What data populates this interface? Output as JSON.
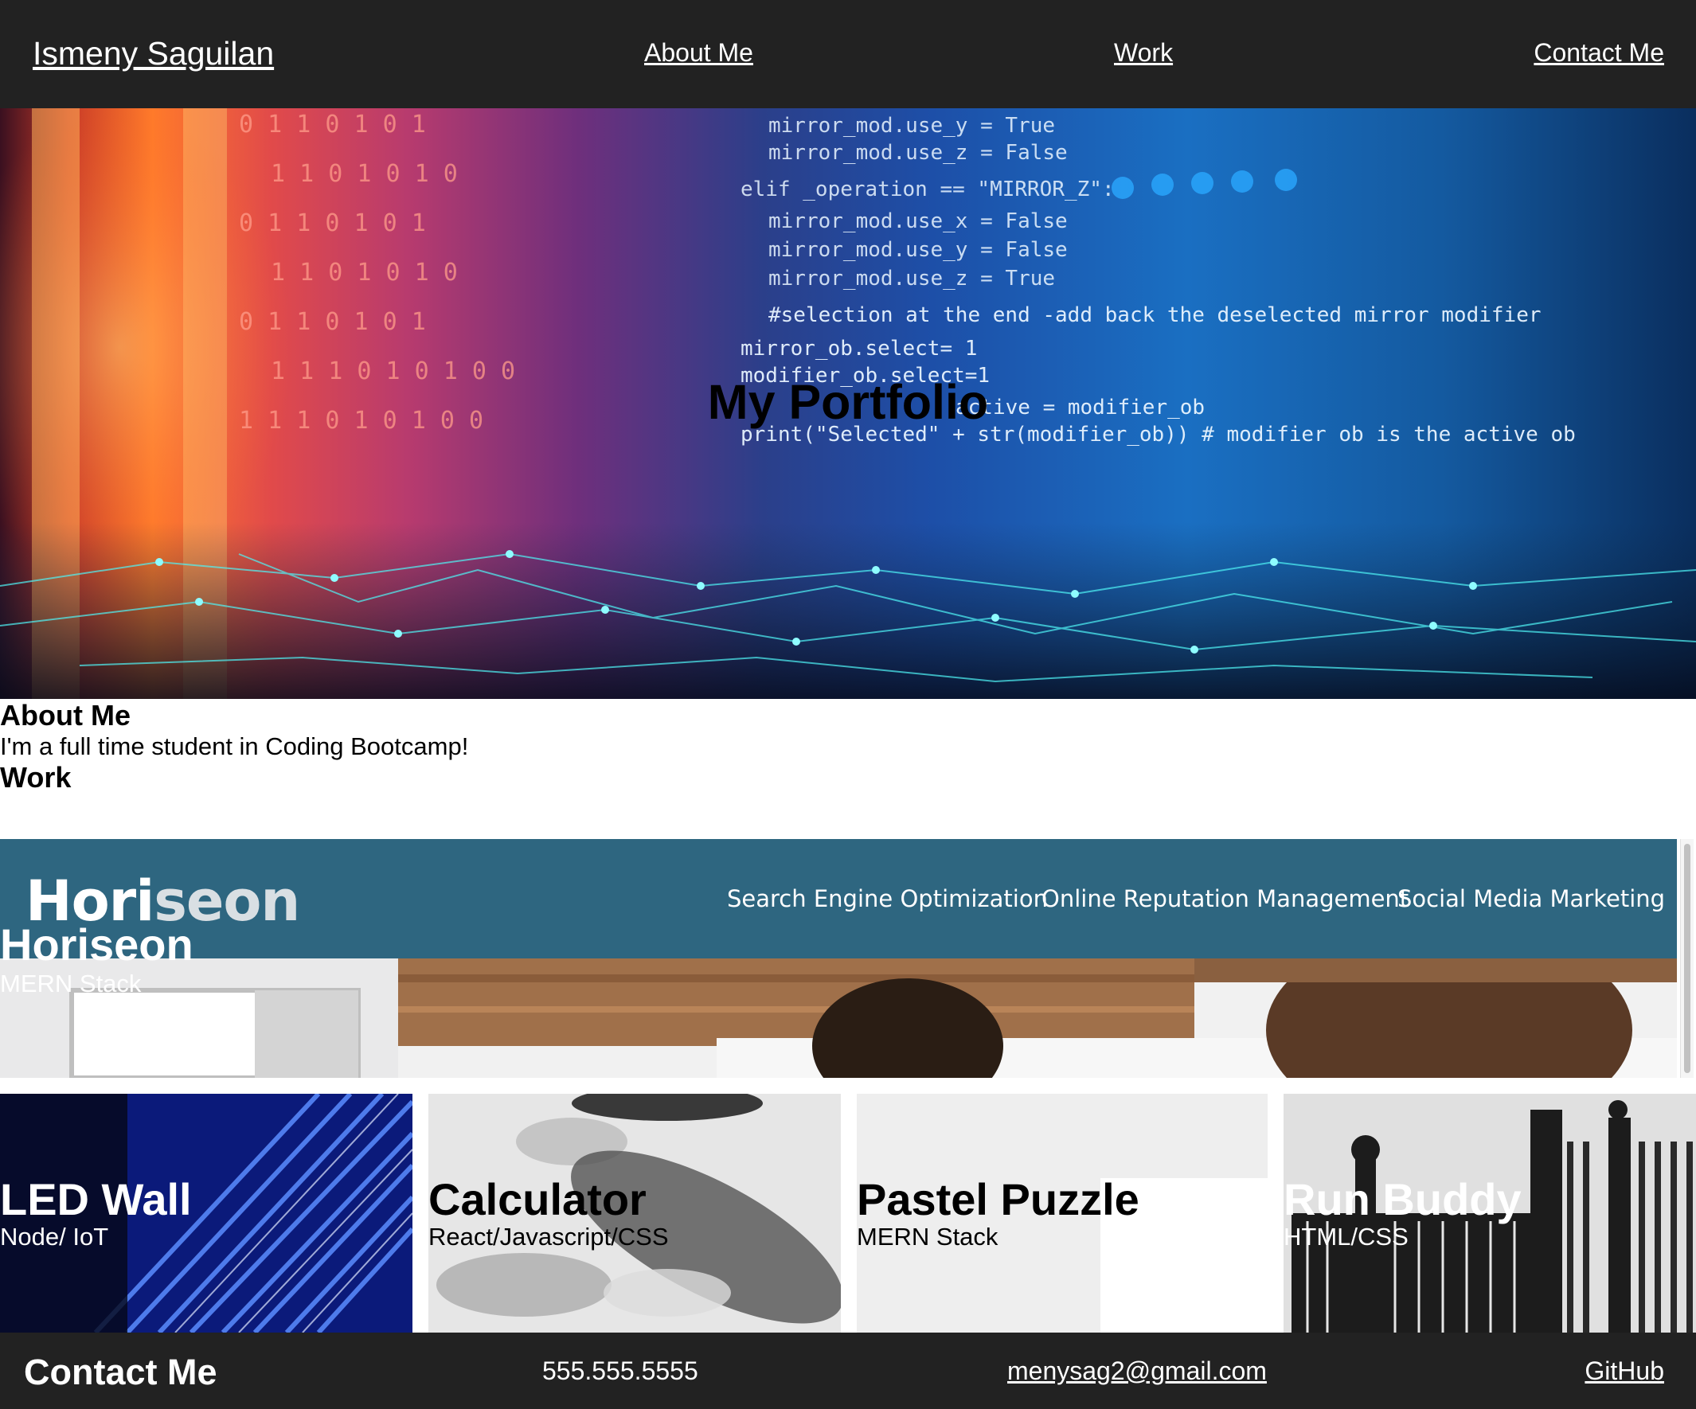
{
  "header": {
    "brand": "Ismeny Saguilan",
    "nav": {
      "about": "About Me",
      "work": "Work",
      "contact": "Contact Me"
    }
  },
  "hero": {
    "title": "My Portfolio",
    "code_lines": [
      "mirror_mod.use_y = True",
      "mirror_mod.use_z = False",
      "elif _operation == \"MIRROR_Z\":",
      "mirror_mod.use_x = False",
      "mirror_mod.use_y = False",
      "mirror_mod.use_z = True",
      "#selection at the end -add back the deselected mirror modifier",
      "mirror_ob.select= 1",
      "modifier_ob.select=1",
      "active = modifier_ob",
      "print(\"Selected\" + str(modifier_ob)) # modifier ob is the active ob"
    ],
    "binary_rows": [
      "0 1 1 0 1 0 1",
      "1 1 0 1 0 1 0",
      "0 1 1 0 1 0 1",
      "1 1 0 1 0 1 0",
      "0 1 1 0 1 0 1",
      "1 1 1 0 1 0 1 0 0",
      "1 1 1 0 1 0 1 0 0"
    ]
  },
  "about": {
    "heading": "About Me",
    "text": "I'm a full time student in Coding Bootcamp!"
  },
  "work": {
    "heading": "Work",
    "featured": {
      "logo_a": "Hori",
      "logo_b": "seon",
      "menu": [
        "Search Engine Optimization",
        "Online Reputation Management",
        "Social Media Marketing"
      ],
      "title": "Horiseon",
      "subtitle": "MERN Stack"
    },
    "projects": [
      {
        "title": "LED Wall",
        "subtitle": "Node/ IoT"
      },
      {
        "title": "Calculator",
        "subtitle": "React/Javascript/CSS"
      },
      {
        "title": "Pastel Puzzle",
        "subtitle": "MERN Stack"
      },
      {
        "title": "Run Buddy",
        "subtitle": "HTML/CSS"
      }
    ]
  },
  "footer": {
    "title": "Contact Me",
    "phone": "555.555.5555",
    "email": "menysag2@gmail.com",
    "github": "GitHub"
  },
  "colors": {
    "header_bg": "#222222",
    "footer_bg": "#222222",
    "horiseon_bar": "#2e6680"
  }
}
